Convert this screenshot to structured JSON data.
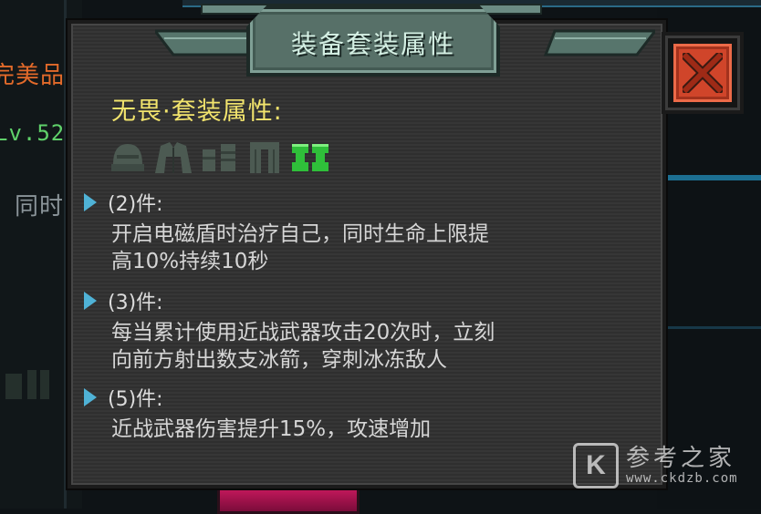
{
  "background": {
    "left_label_1": "完美品",
    "left_label_2": "Lv.52",
    "left_label_3": "同时"
  },
  "dialog": {
    "title": "装备套装属性",
    "set_name": "无畏·套装属性:",
    "equipment_icons": [
      "helmet-icon",
      "armor-icon",
      "gloves-icon",
      "pants-icon",
      "boots-icon"
    ],
    "active_slot": "boots-icon",
    "tiers": [
      {
        "label": "(2)件:",
        "desc_line1": "开启电磁盾时治疗自己，同时生命上限提",
        "desc_line2": "高10%持续10秒"
      },
      {
        "label": "(3)件:",
        "desc_line1": "每当累计使用近战武器攻击20次时，立刻",
        "desc_line2": "向前方射出数支冰箭，穿刺冰冻敌人"
      },
      {
        "label": "(5)件:",
        "desc_line1": "近战武器伤害提升15%，攻速增加",
        "desc_line2": ""
      }
    ],
    "close_icon": "close-x-icon"
  },
  "watermark": {
    "logo_letter": "K",
    "text": "参考之家",
    "url": "www.ckdzb.com"
  },
  "colors": {
    "title_text": "#d5f0e4",
    "set_name": "#f2e46d",
    "bullet": "#4fb2d6",
    "close_bg": "#d0452a",
    "active_equip": "#2fbf3a",
    "inactive_equip": "#4c5a52"
  }
}
